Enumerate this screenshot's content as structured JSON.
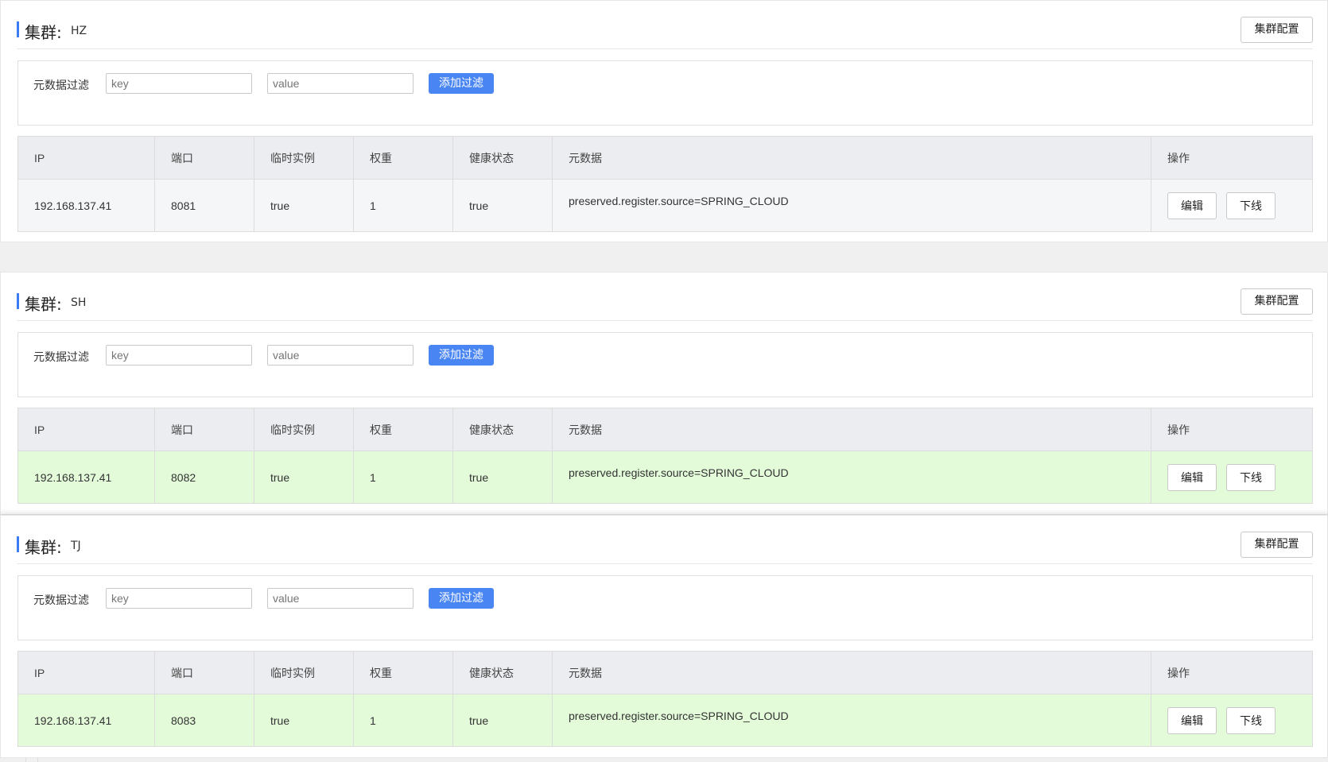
{
  "filter": {
    "label": "元数据过滤",
    "key_placeholder": "key",
    "value_placeholder": "value",
    "add_button": "添加过滤"
  },
  "cluster_config_button": "集群配置",
  "cluster_prefix": "集群:",
  "columns": [
    "IP",
    "端口",
    "临时实例",
    "权重",
    "健康状态",
    "元数据",
    "操作"
  ],
  "actions": {
    "edit": "编辑",
    "offline": "下线"
  },
  "clusters": [
    {
      "name": "HZ",
      "row": {
        "ip": "192.168.137.41",
        "port": "8081",
        "ephemeral": "true",
        "weight": "1",
        "healthy": "true",
        "metadata": "preserved.register.source=SPRING_CLOUD"
      }
    },
    {
      "name": "SH",
      "row": {
        "ip": "192.168.137.41",
        "port": "8082",
        "ephemeral": "true",
        "weight": "1",
        "healthy": "true",
        "metadata": "preserved.register.source=SPRING_CLOUD"
      }
    },
    {
      "name": "TJ",
      "row": {
        "ip": "192.168.137.41",
        "port": "8083",
        "ephemeral": "true",
        "weight": "1",
        "healthy": "true",
        "metadata": "preserved.register.source=SPRING_CLOUD"
      }
    }
  ],
  "colors": {
    "accent": "#3b7cf5",
    "add_button_bg": "#4a86f3",
    "healthy_row_bg": "#e3fbd9",
    "header_bg": "#ebedf0"
  }
}
